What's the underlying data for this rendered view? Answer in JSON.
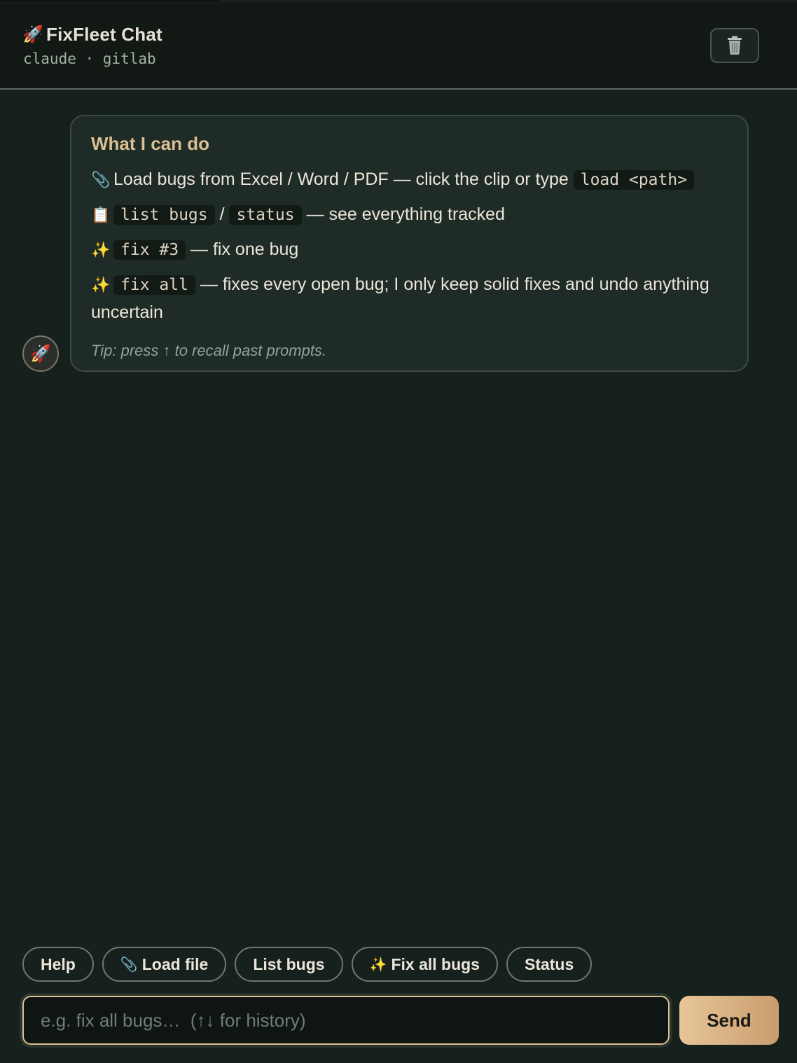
{
  "header": {
    "icon": "🚀",
    "title": "FixFleet Chat",
    "subtitle": "claude · gitlab",
    "clear_icon": "trash-icon"
  },
  "message": {
    "avatar": "🚀",
    "title": "What I can do",
    "lines": [
      {
        "emoji": "📎",
        "pre": "Load bugs from Excel / Word / PDF — click the clip or type ",
        "code": "load <path>"
      },
      {
        "emoji": "📋",
        "code1": "list bugs",
        "sep": " / ",
        "code2": "status",
        "post": " — see everything tracked"
      },
      {
        "emoji": "✨",
        "code": "fix #3",
        "post": " — fix one bug"
      },
      {
        "emoji": "✨",
        "code": "fix all",
        "post": " — fixes every open bug; I only keep solid fixes and undo anything uncertain"
      }
    ],
    "tip": "Tip: press ↑ to recall past prompts."
  },
  "chips": [
    {
      "icon": "",
      "label": "Help"
    },
    {
      "icon": "📎",
      "label": "Load file"
    },
    {
      "icon": "",
      "label": "List bugs"
    },
    {
      "icon": "✨",
      "label": "Fix all bugs"
    },
    {
      "icon": "",
      "label": "Status"
    }
  ],
  "composer": {
    "placeholder": "e.g. fix all bugs…  (↑↓ for history)",
    "value": "",
    "send_label": "Send"
  },
  "colors": {
    "accent": "#d8c28f",
    "background": "#16201c",
    "card": "#1f2b26",
    "title_gold": "#d8bf94"
  }
}
